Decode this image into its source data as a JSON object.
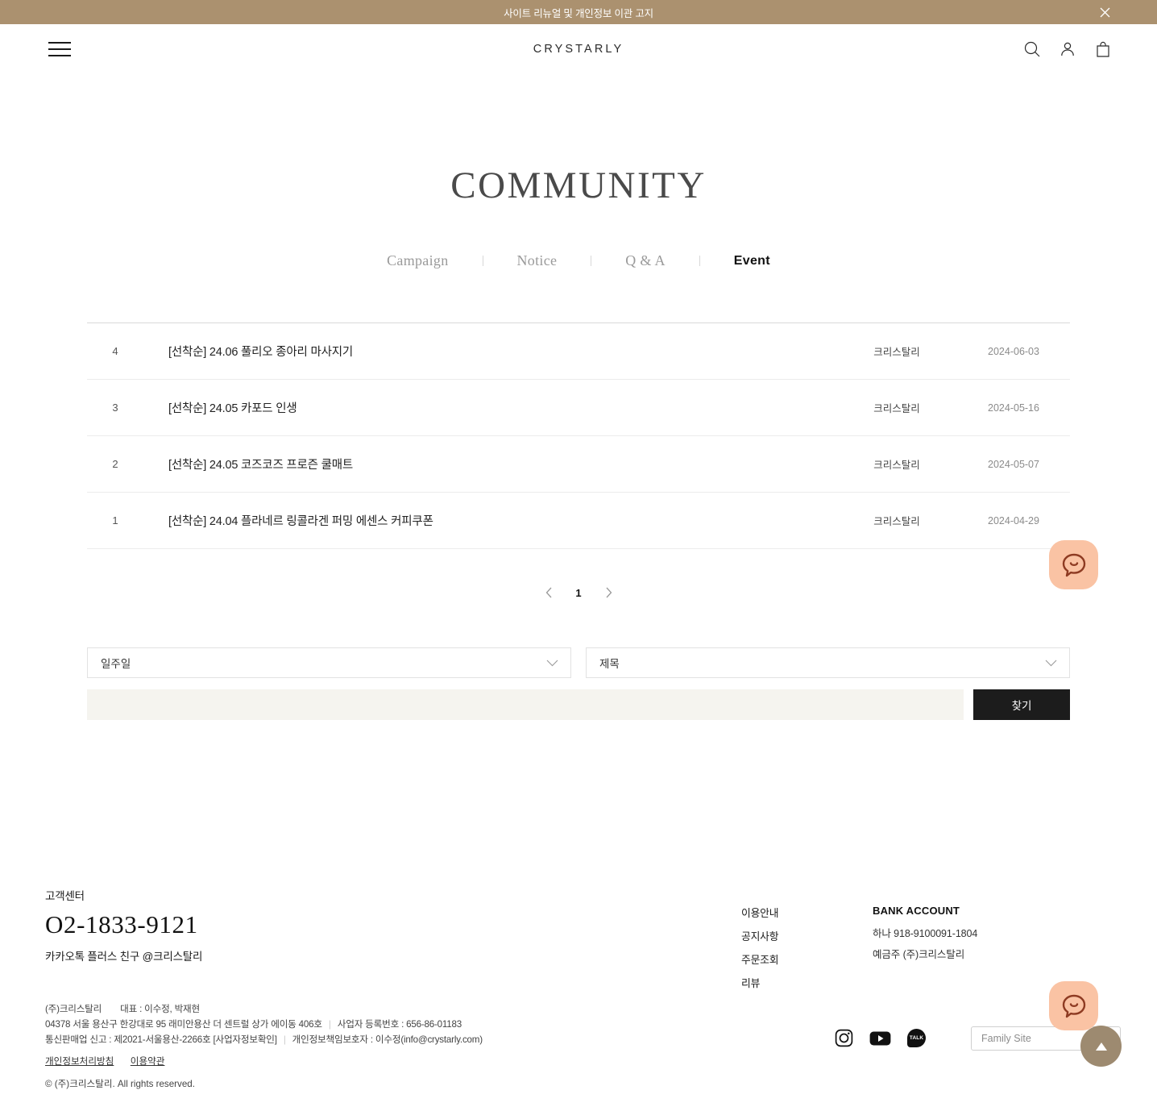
{
  "banner": {
    "text": "사이트 리뉴얼 및 개인정보 이관 고지",
    "close_icon": "close-icon",
    "bg_color": "#ab916f"
  },
  "header": {
    "menu_icon": "hamburger-icon",
    "logo": "CRYSTARLY",
    "icons": [
      "search-icon",
      "account-icon",
      "cart-icon"
    ]
  },
  "page": {
    "title": "COMMUNITY"
  },
  "tabs": [
    {
      "label": "Campaign",
      "active": false
    },
    {
      "label": "Notice",
      "active": false
    },
    {
      "label": "Q & A",
      "active": false
    },
    {
      "label": "Event",
      "active": true
    }
  ],
  "board": {
    "rows": [
      {
        "no": "4",
        "title": "[선착순] 24.06 풀리오 종아리 마사지기",
        "author": "크리스탈리",
        "date": "2024-06-03"
      },
      {
        "no": "3",
        "title": "[선착순] 24.05 카포드 인생",
        "author": "크리스탈리",
        "date": "2024-05-16"
      },
      {
        "no": "2",
        "title": "[선착순] 24.05 코즈코즈 프로즌 쿨매트",
        "author": "크리스탈리",
        "date": "2024-05-07"
      },
      {
        "no": "1",
        "title": "[선착순] 24.04 플라네르 링콜라겐 퍼밍 에센스 커피쿠폰",
        "author": "크리스탈리",
        "date": "2024-04-29"
      }
    ]
  },
  "pagination": {
    "prev_icon": "chevron-left-icon",
    "next_icon": "chevron-right-icon",
    "current_page": "1"
  },
  "filter": {
    "period_select": {
      "value": "일주일",
      "icon": "chevron-down-icon"
    },
    "field_select": {
      "value": "제목",
      "icon": "chevron-down-icon"
    },
    "keyword_value": "",
    "keyword_placeholder": "",
    "search_button": "찾기"
  },
  "footer": {
    "cs_title": "고객센터",
    "cs_phone": "O2-1833-9121",
    "cs_kakao": "카카오톡 플러스 친구 @크리스탈리",
    "links": [
      "이용안내",
      "공지사항",
      "주문조회",
      "리뷰"
    ],
    "bank": {
      "title": "BANK ACCOUNT",
      "account": "하나 918-9100091-1804",
      "holder": "예금주 (주)크리스탈리"
    },
    "legal": {
      "line1_company": "(주)크리스탈리",
      "line1_ceo": "대표 : 이수정, 박재현",
      "line2_address": "04378 서울 용산구 한강대로 95 래미안용산 더 센트럴 상가 에이동 406호",
      "line2_biznum": "사업자 등록번호 : 656-86-01183",
      "line3_mailorder": "통신판매업 신고 : 제2021-서울용산-2266호 [사업자정보확인]",
      "line3_privacy_officer": "개인정보책임보호자 : 이수정(info@crystarly.com)",
      "policy_link": "개인정보처리방침",
      "terms_link": "이용약관",
      "copyright": "© (주)크리스탈리. All rights reserved."
    },
    "socials": [
      "instagram-icon",
      "youtube-icon",
      "kakaotalk-icon"
    ],
    "kakao_label": "TALK",
    "family_site": "Family Site"
  },
  "floating": {
    "chat_icon": "chat-bubble-smiley-icon",
    "chat_color": "#fac3a4",
    "scroll_top_icon": "triangle-up-icon",
    "scroll_top_color": "#9d8a70"
  }
}
